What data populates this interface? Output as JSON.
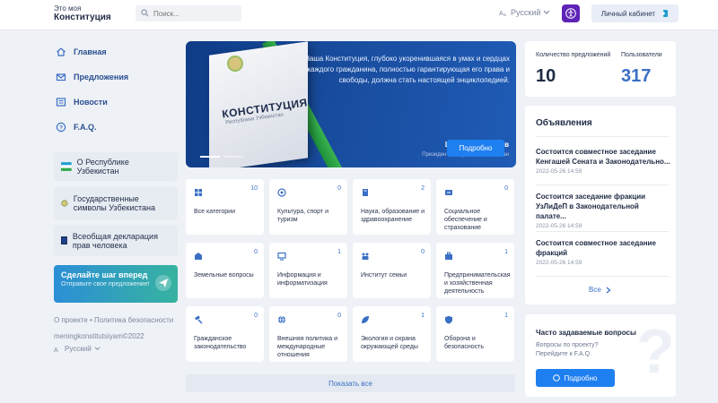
{
  "header": {
    "logo_line1": "Это моя",
    "logo_line2": "Конституция",
    "search_placeholder": "Поиск...",
    "language": "Русский",
    "cabinet_label": "Личный кабинет"
  },
  "sidebar": {
    "nav": [
      {
        "label": "Главная",
        "icon": "home-icon"
      },
      {
        "label": "Предложения",
        "icon": "mail-icon"
      },
      {
        "label": "Новости",
        "icon": "news-icon"
      },
      {
        "label": "F.A.Q.",
        "icon": "help-icon"
      }
    ],
    "links": [
      {
        "label": "О Республике Узбекистан",
        "icon": "flag-icon"
      },
      {
        "label": "Государственные символы Узбекистана",
        "icon": "emblem-icon"
      },
      {
        "label": "Всеобщая декларация прав человека",
        "icon": "book-icon"
      }
    ],
    "promo_title": "Сделайте шаг вперед",
    "promo_subtitle": "Отправьте свое предложение!",
    "footer_links": "О проекте • Политика безопасности",
    "copyright": "meningkonstitutsiyam©2022",
    "footer_language": "Русский"
  },
  "hero": {
    "book_title": "КОНСТИТУЦИЯ",
    "book_subtitle": "Республики Узбекистан",
    "quote": "Наша Конституция, глубоко укоренившаяся в умах и сердцах каждого гражданина, полностью гарантирующая его права и свободы, должна стать настоящей энциклопедией.",
    "author": "Шавкат Мирзиёев",
    "role": "Президент Республики Узбекистан",
    "button": "Подробно"
  },
  "categories": [
    {
      "label": "Все категории",
      "count": "10",
      "icon": "grid-icon"
    },
    {
      "label": "Культура, спорт и туризм",
      "count": "0",
      "icon": "culture-icon"
    },
    {
      "label": "Наука, образование и здравоохранение",
      "count": "2",
      "icon": "science-icon"
    },
    {
      "label": "Социальное обеспечение и страхование",
      "count": "0",
      "icon": "social-icon"
    },
    {
      "label": "Земельные вопросы",
      "count": "0",
      "icon": "land-icon"
    },
    {
      "label": "Информация и информатизация",
      "count": "1",
      "icon": "monitor-icon"
    },
    {
      "label": "Институт семьи",
      "count": "0",
      "icon": "family-icon"
    },
    {
      "label": "Предпринимательская и хозяйственная деятельность",
      "count": "1",
      "icon": "business-icon"
    },
    {
      "label": "Гражданское законодательство",
      "count": "0",
      "icon": "gavel-icon"
    },
    {
      "label": "Внешняя политика и международные отношения",
      "count": "0",
      "icon": "globe-icon"
    },
    {
      "label": "Экология и охрана окружающей среды",
      "count": "1",
      "icon": "leaf-icon"
    },
    {
      "label": "Оборона и безопасность",
      "count": "1",
      "icon": "shield-icon"
    }
  ],
  "show_all": "Показать все",
  "stats": {
    "proposals_label": "Количество предложений",
    "proposals_value": "10",
    "users_label": "Пользователи",
    "users_value": "317"
  },
  "announcements": {
    "title": "Объявления",
    "items": [
      {
        "title": "Состоится совместное заседание Кенгашей Сената и Законодательно...",
        "date": "2022-05-26 14:59"
      },
      {
        "title": "Состоится заседание фракции УзЛиДеП в Законодательной палате...",
        "date": "2022-05-26 14:59"
      },
      {
        "title": "Состоится совместное заседание фракций",
        "date": "2022-05-26 14:59"
      }
    ],
    "all_label": "Все"
  },
  "faq": {
    "title": "Часто задаваемые вопросы",
    "subtitle": "Вопросы по проекту? Перейдите к F.A.Q.",
    "button": "Подробно"
  },
  "colors": {
    "accent": "#1e7ff0",
    "brand_purple": "#5e24b6",
    "hero_bg": "#1a4fa2"
  }
}
